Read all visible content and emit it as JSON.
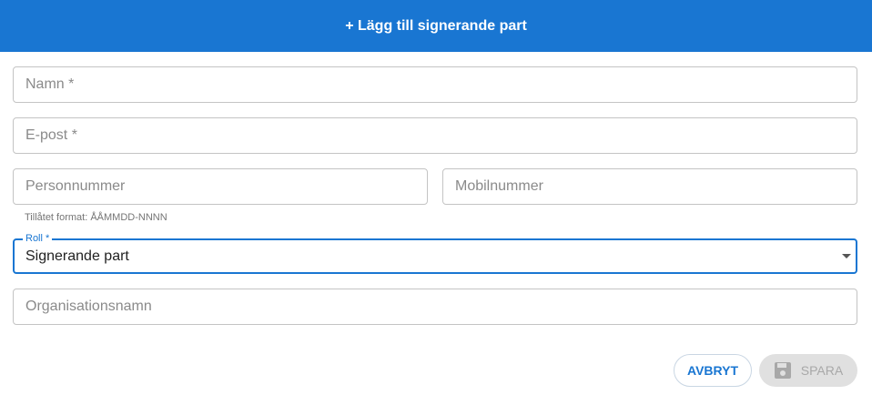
{
  "dialog": {
    "title": "+ Lägg till signerande part"
  },
  "form": {
    "name_placeholder": "Namn *",
    "email_placeholder": "E-post *",
    "personal_number_placeholder": "Personnummer",
    "personal_number_helper": "Tillåtet format: ÅÅMMDD-NNNN",
    "mobile_placeholder": "Mobilnummer",
    "role": {
      "label": "Roll *",
      "value": "Signerande part"
    },
    "organization_placeholder": "Organisationsnamn"
  },
  "actions": {
    "cancel_label": "AVBRYT",
    "save_label": "SPARA",
    "save_icon": "floppy-disk-icon"
  },
  "colors": {
    "primary": "#1976d2",
    "disabled_bg": "#e0e0e0",
    "disabled_text": "#a8a8a8"
  }
}
